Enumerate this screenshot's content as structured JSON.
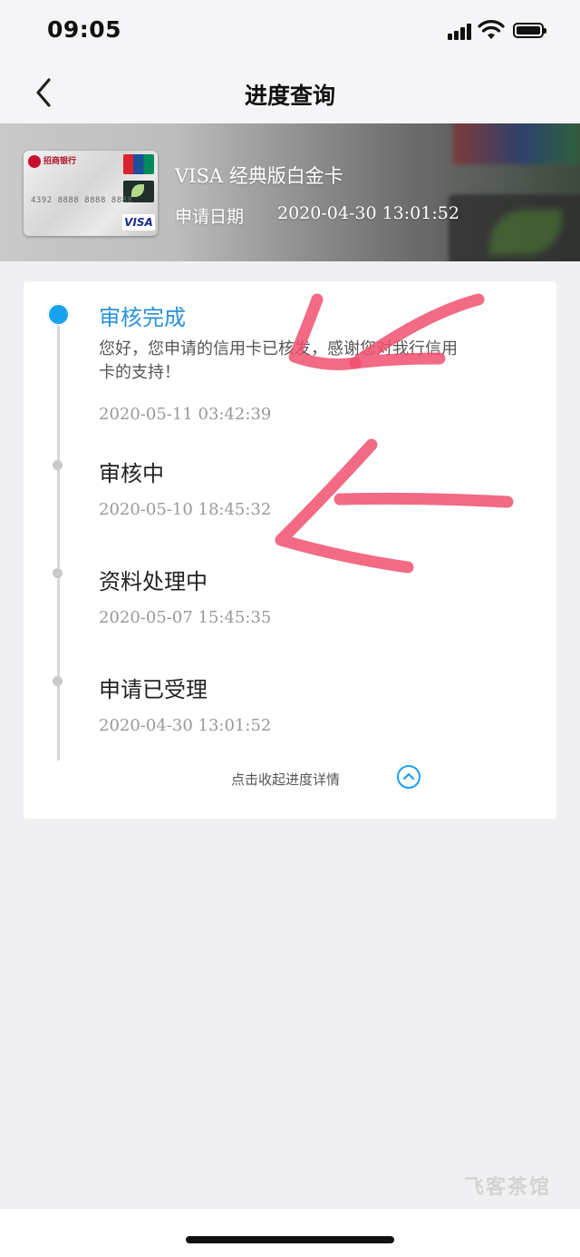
{
  "status_bar": {
    "time": "09:05"
  },
  "header": {
    "title": "进度查询",
    "back_icon": "chevron-left-icon"
  },
  "card": {
    "bank_name": "招商银行",
    "card_name": "VISA 经典版白金卡",
    "apply_date_label": "申请日期",
    "apply_date": "2020-04-30 13:01:52",
    "card_number": "4392 8888 8888 8888",
    "network_mark": "VISA"
  },
  "progress": {
    "steps": [
      {
        "title": "审核完成",
        "description": "您好，您申请的信用卡已核发，感谢您对我行信用卡的支持！",
        "time": "2020-05-11 03:42:39",
        "active": true
      },
      {
        "title": "审核中",
        "time": "2020-05-10 18:45:32",
        "active": false
      },
      {
        "title": "资料处理中",
        "time": "2020-05-07 15:45:35",
        "active": false
      },
      {
        "title": "申请已受理",
        "time": "2020-04-30 13:01:52",
        "active": false
      }
    ],
    "collapse_label": "点击收起进度详情"
  },
  "colors": {
    "accent": "#19a2f0",
    "active_title": "#2a93d8",
    "annotation_arrow": "#f0506e"
  },
  "watermark": {
    "text": "飞客茶馆"
  }
}
